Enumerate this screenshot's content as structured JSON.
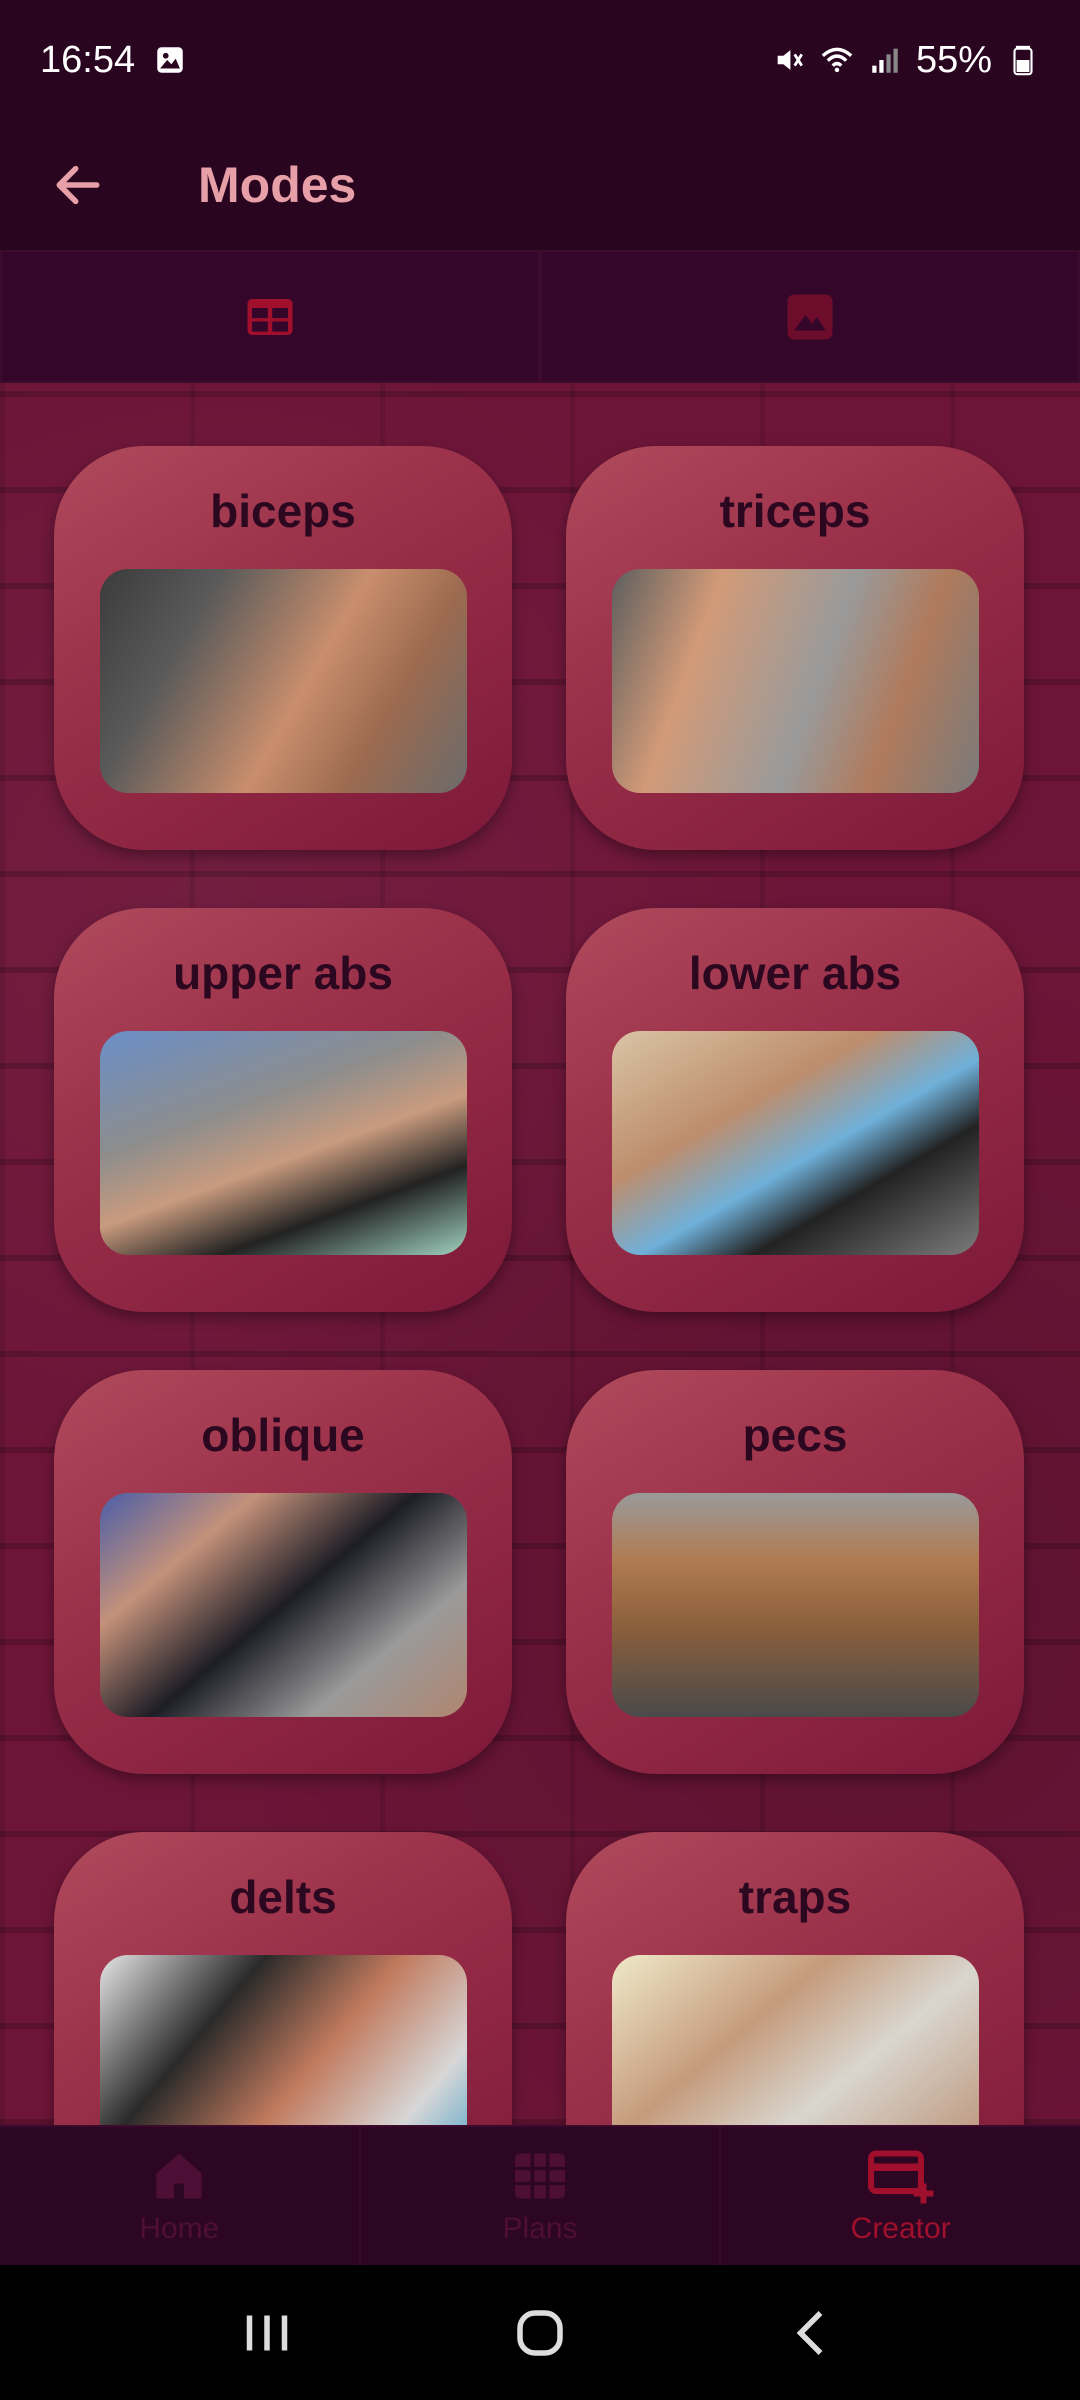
{
  "status_bar": {
    "time": "16:54",
    "battery": "55%",
    "icons": [
      "gallery-icon",
      "mute-icon",
      "wifi-icon",
      "signal-icon",
      "battery-icon"
    ]
  },
  "app_bar": {
    "title": "Modes",
    "back_icon": "arrow-left-icon"
  },
  "tabs": [
    {
      "icon": "grid-icon",
      "selected": true
    },
    {
      "icon": "image-icon",
      "selected": false
    }
  ],
  "modes": [
    {
      "label": "biceps",
      "image": "biceps-photo"
    },
    {
      "label": "triceps",
      "image": "triceps-photo"
    },
    {
      "label": "upper abs",
      "image": "upper-abs-photo"
    },
    {
      "label": "lower abs",
      "image": "lower-abs-photo"
    },
    {
      "label": "oblique",
      "image": "oblique-photo"
    },
    {
      "label": "pecs",
      "image": "pecs-photo"
    },
    {
      "label": "delts",
      "image": "delts-photo"
    },
    {
      "label": "traps",
      "image": "traps-photo"
    }
  ],
  "bottom_nav": [
    {
      "label": "Home",
      "icon": "home-icon",
      "active": false
    },
    {
      "label": "Plans",
      "icon": "table-icon",
      "active": false
    },
    {
      "label": "Creator",
      "icon": "card-add-icon",
      "active": true
    }
  ],
  "colors": {
    "background": "#2a0520",
    "accent": "#a0102c",
    "title": "#e8a0a8",
    "card": "#9a3049"
  }
}
